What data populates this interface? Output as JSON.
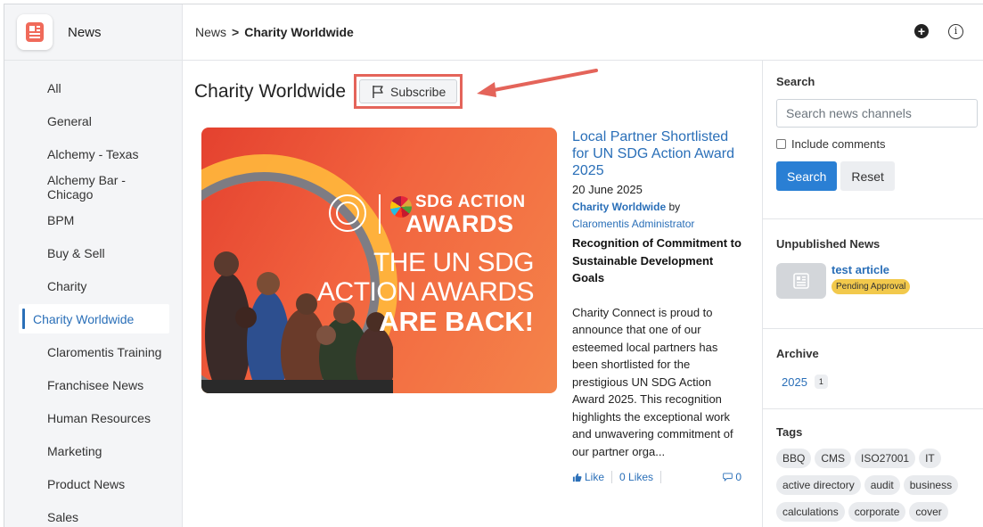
{
  "app": {
    "title": "News"
  },
  "breadcrumb": {
    "root": "News",
    "separator": ">",
    "current": "Charity Worldwide"
  },
  "sidebar": {
    "items": [
      {
        "label": "All"
      },
      {
        "label": "General"
      },
      {
        "label": "Alchemy - Texas"
      },
      {
        "label": "Alchemy Bar - Chicago"
      },
      {
        "label": "BPM"
      },
      {
        "label": "Buy & Sell"
      },
      {
        "label": "Charity"
      },
      {
        "label": "Charity Worldwide",
        "active": true
      },
      {
        "label": "Claromentis Training"
      },
      {
        "label": "Franchisee News"
      },
      {
        "label": "Human Resources"
      },
      {
        "label": "Marketing"
      },
      {
        "label": "Product News"
      },
      {
        "label": "Sales"
      }
    ]
  },
  "main": {
    "page_title": "Charity Worldwide",
    "subscribe_label": "Subscribe",
    "hero": {
      "sdg_line1": "SDG ACTION",
      "sdg_line2": "AWARDS",
      "line1": "THE UN SDG",
      "line2": "ACTION AWARDS",
      "line3": "ARE BACK!"
    },
    "article": {
      "title": "Local Partner Shortlisted for UN SDG Action Award 2025",
      "date": "20 June 2025",
      "channel": "Charity Worldwide",
      "by": "by",
      "author": "Claromentis Administrator",
      "subtitle": "Recognition of Commitment to Sustainable Development Goals",
      "body": "Charity Connect is proud to announce that one of our esteemed local partners has been shortlisted for the prestigious UN SDG Action Award 2025. This recognition highlights the exceptional work and unwavering commitment of our partner orga...",
      "like_label": "Like",
      "likes_count": "0 Likes",
      "comments_count": "0"
    }
  },
  "right": {
    "search": {
      "title": "Search",
      "placeholder": "Search news channels",
      "include_comments": "Include comments",
      "search_button": "Search",
      "reset_button": "Reset"
    },
    "unpublished": {
      "title": "Unpublished News",
      "item_title": "test article",
      "status": "Pending Approval",
      "status_color": "#f2c94c"
    },
    "archive": {
      "title": "Archive",
      "year": "2025",
      "count": "1"
    },
    "tags": {
      "title": "Tags",
      "items": [
        "BBQ",
        "CMS",
        "ISO27001",
        "IT",
        "active directory",
        "audit",
        "business",
        "calculations",
        "corporate",
        "cover"
      ]
    }
  },
  "colors": {
    "accent": "#2a6fb8",
    "primary_button": "#2a7fd4",
    "annotation": "#e4645a"
  }
}
